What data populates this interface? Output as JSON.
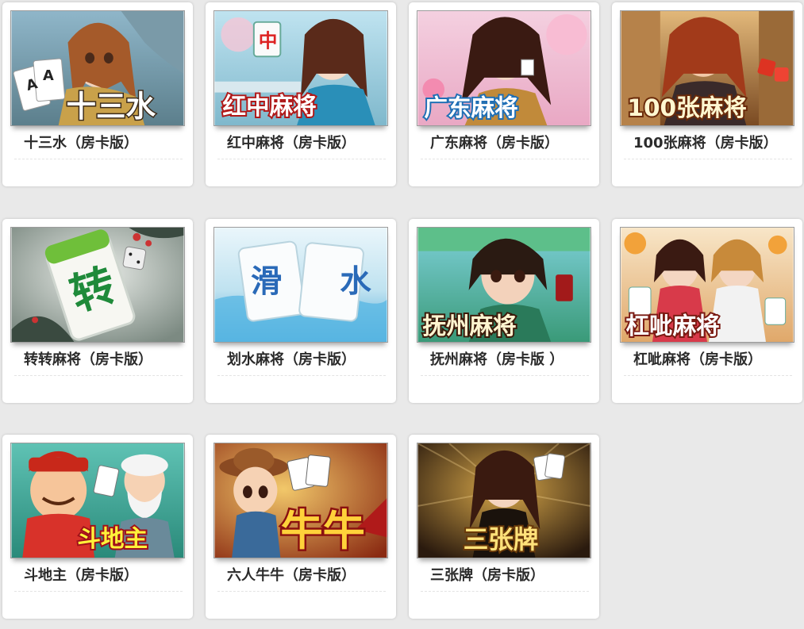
{
  "games": [
    {
      "title": "十三水（房卡版）",
      "logo": "十三水"
    },
    {
      "title": "红中麻将（房卡版）",
      "logo": "红中麻将"
    },
    {
      "title": "广东麻将（房卡版）",
      "logo": "广东麻将"
    },
    {
      "title": "100张麻将（房卡版）",
      "logo": "100张麻将"
    },
    {
      "title": "转转麻将（房卡版）",
      "logo": "转"
    },
    {
      "title": "划水麻将（房卡版）",
      "logo": "滑 水"
    },
    {
      "title": "抚州麻将（房卡版 ）",
      "logo": "抚州麻将"
    },
    {
      "title": "杠呲麻将（房卡版）",
      "logo": "杠呲麻将"
    },
    {
      "title": "斗地主（房卡版）",
      "logo": "斗地主"
    },
    {
      "title": "六人牛牛（房卡版）",
      "logo": "牛牛"
    },
    {
      "title": "三张牌（房卡版）",
      "logo": "三张牌"
    }
  ],
  "colors": {
    "page_bg": "#e9e9e9",
    "card_bg": "#ffffff",
    "caption_text": "#2b2b2b"
  }
}
